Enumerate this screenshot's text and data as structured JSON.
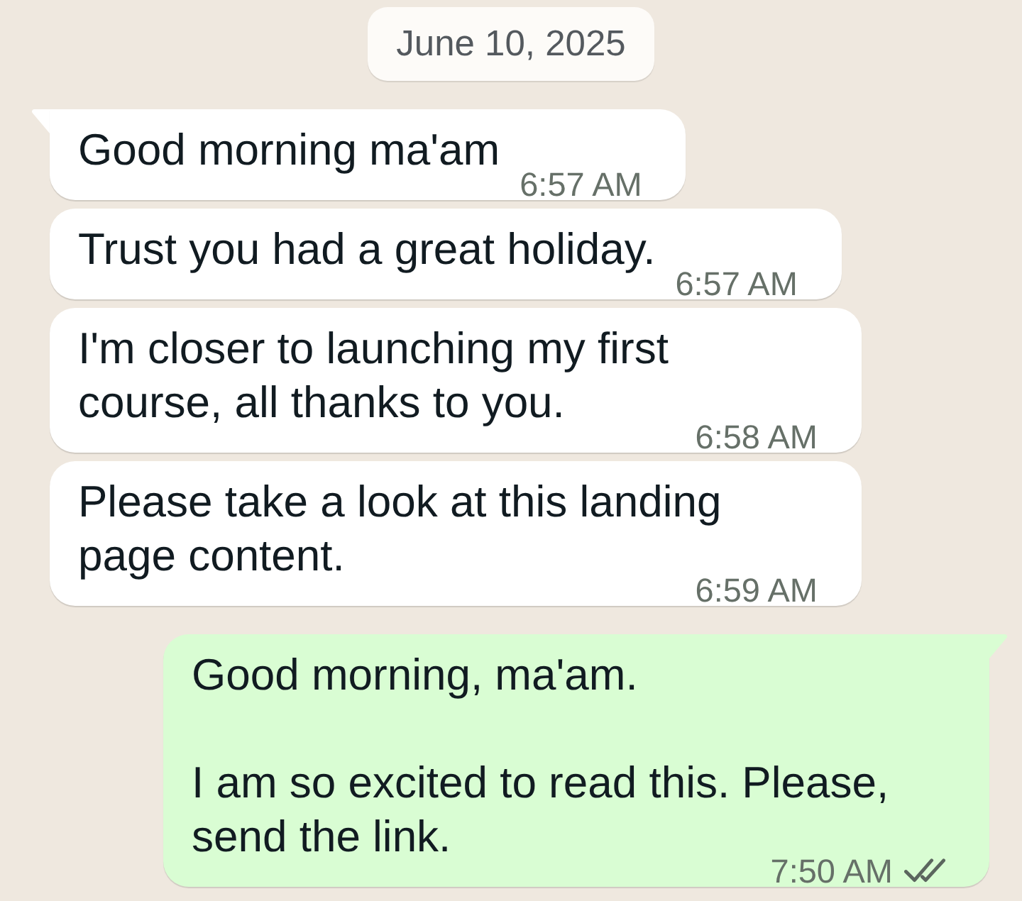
{
  "date_chip": "June 10, 2025",
  "messages": [
    {
      "kind": "incoming",
      "tail": true,
      "paragraphs": [
        "Good morning ma'am"
      ],
      "time": "6:57 AM"
    },
    {
      "kind": "incoming",
      "tail": false,
      "paragraphs": [
        "Trust you had a great holiday."
      ],
      "time": "6:57 AM"
    },
    {
      "kind": "incoming",
      "tail": false,
      "paragraphs": [
        "I'm closer to launching my first course, all thanks to you."
      ],
      "time": "6:58 AM"
    },
    {
      "kind": "incoming",
      "tail": false,
      "paragraphs": [
        "Please take a look at this landing page content."
      ],
      "time": "6:59 AM"
    },
    {
      "kind": "outgoing",
      "tail": true,
      "paragraphs": [
        "Good morning, ma'am.",
        "I am so excited to read this. Please, send the link."
      ],
      "time": "7:50 AM",
      "delivered": true,
      "read": false
    }
  ]
}
